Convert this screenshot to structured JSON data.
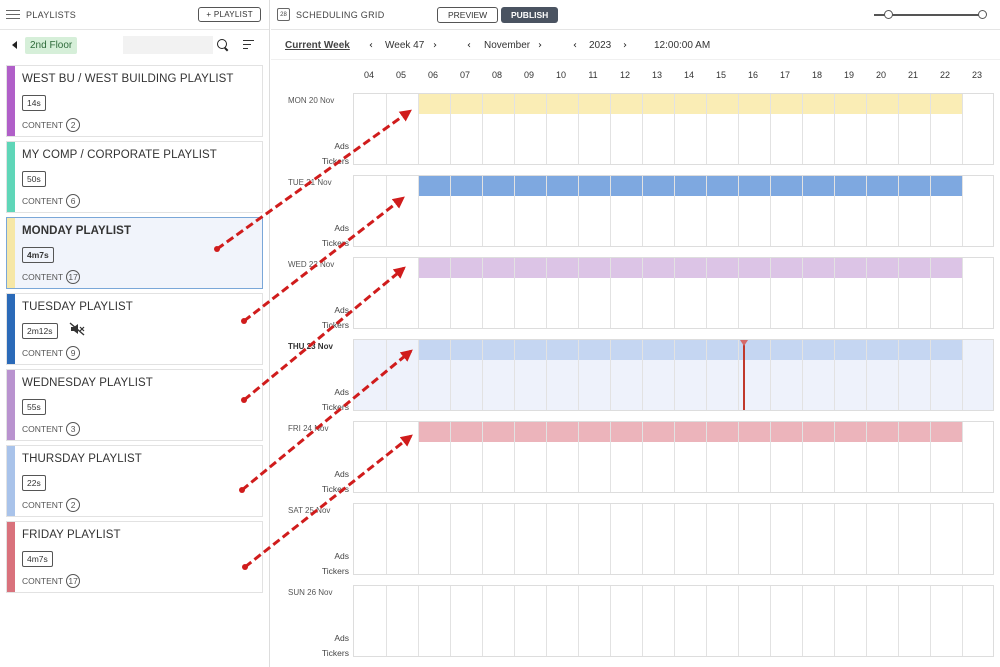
{
  "left_panel": {
    "title": "PLAYLISTS",
    "add_button": "+ PLAYLIST",
    "floor": "2nd Floor",
    "content_label": "CONTENT",
    "playlists": [
      {
        "name": "WEST BU /  WEST BUILDING PLAYLIST",
        "duration": "14s",
        "content_count": "2",
        "color": "#b05fc8",
        "selected": false,
        "muted": false
      },
      {
        "name": "MY COMP /  CORPORATE PLAYLIST",
        "duration": "50s",
        "content_count": "6",
        "color": "#5fd6b8",
        "selected": false,
        "muted": false
      },
      {
        "name": "MONDAY PLAYLIST",
        "duration": "4m7s",
        "content_count": "17",
        "color": "#f6e7a6",
        "selected": true,
        "muted": false
      },
      {
        "name": "TUESDAY PLAYLIST",
        "duration": "2m12s",
        "content_count": "9",
        "color": "#2b6ab8",
        "selected": false,
        "muted": true
      },
      {
        "name": "WEDNESDAY PLAYLIST",
        "duration": "55s",
        "content_count": "3",
        "color": "#b993cf",
        "selected": false,
        "muted": false
      },
      {
        "name": "THURSDAY PLAYLIST",
        "duration": "22s",
        "content_count": "2",
        "color": "#a9c3ea",
        "selected": false,
        "muted": false
      },
      {
        "name": "FRIDAY PLAYLIST",
        "duration": "4m7s",
        "content_count": "17",
        "color": "#d9727c",
        "selected": false,
        "muted": false
      }
    ]
  },
  "header": {
    "title": "SCHEDULING GRID",
    "calendar_icon_text": "28",
    "preview": "PREVIEW",
    "publish": "PUBLISH",
    "zoom_fraction": 0.1
  },
  "nav": {
    "current_week": "Current Week",
    "week": "Week 47",
    "month": "November",
    "year": "2023",
    "time": "12:00:00 AM"
  },
  "hours": [
    "04",
    "05",
    "06",
    "07",
    "08",
    "09",
    "10",
    "11",
    "12",
    "13",
    "14",
    "15",
    "16",
    "17",
    "18",
    "19",
    "20",
    "21",
    "22",
    "23"
  ],
  "track_labels": {
    "ads": "Ads",
    "tickers": "Tickers"
  },
  "days": [
    {
      "label": "MON 20 Nov",
      "bar_color": "#faedb5",
      "bar_start": "06",
      "bar_end": "23",
      "today": false
    },
    {
      "label": "TUE 21 Nov",
      "bar_color": "#7ea8e0",
      "bar_start": "06",
      "bar_end": "23",
      "today": false
    },
    {
      "label": "WED 22 Nov",
      "bar_color": "#dcc4e6",
      "bar_start": "06",
      "bar_end": "23",
      "today": false
    },
    {
      "label": "THU 23 Nov",
      "bar_color": "#c5d6f2",
      "bar_start": "06",
      "bar_end": "23",
      "today": true
    },
    {
      "label": "FRI 24 Nov",
      "bar_color": "#ecb4bb",
      "bar_start": "06",
      "bar_end": "23",
      "today": false
    },
    {
      "label": "SAT 25 Nov",
      "bar_color": "",
      "bar_start": "",
      "bar_end": "",
      "today": false
    },
    {
      "label": "SUN 26 Nov",
      "bar_color": "",
      "bar_start": "",
      "bar_end": "",
      "today": false
    }
  ],
  "current_time_hour": "16",
  "annotation_color": "#d01c1c"
}
